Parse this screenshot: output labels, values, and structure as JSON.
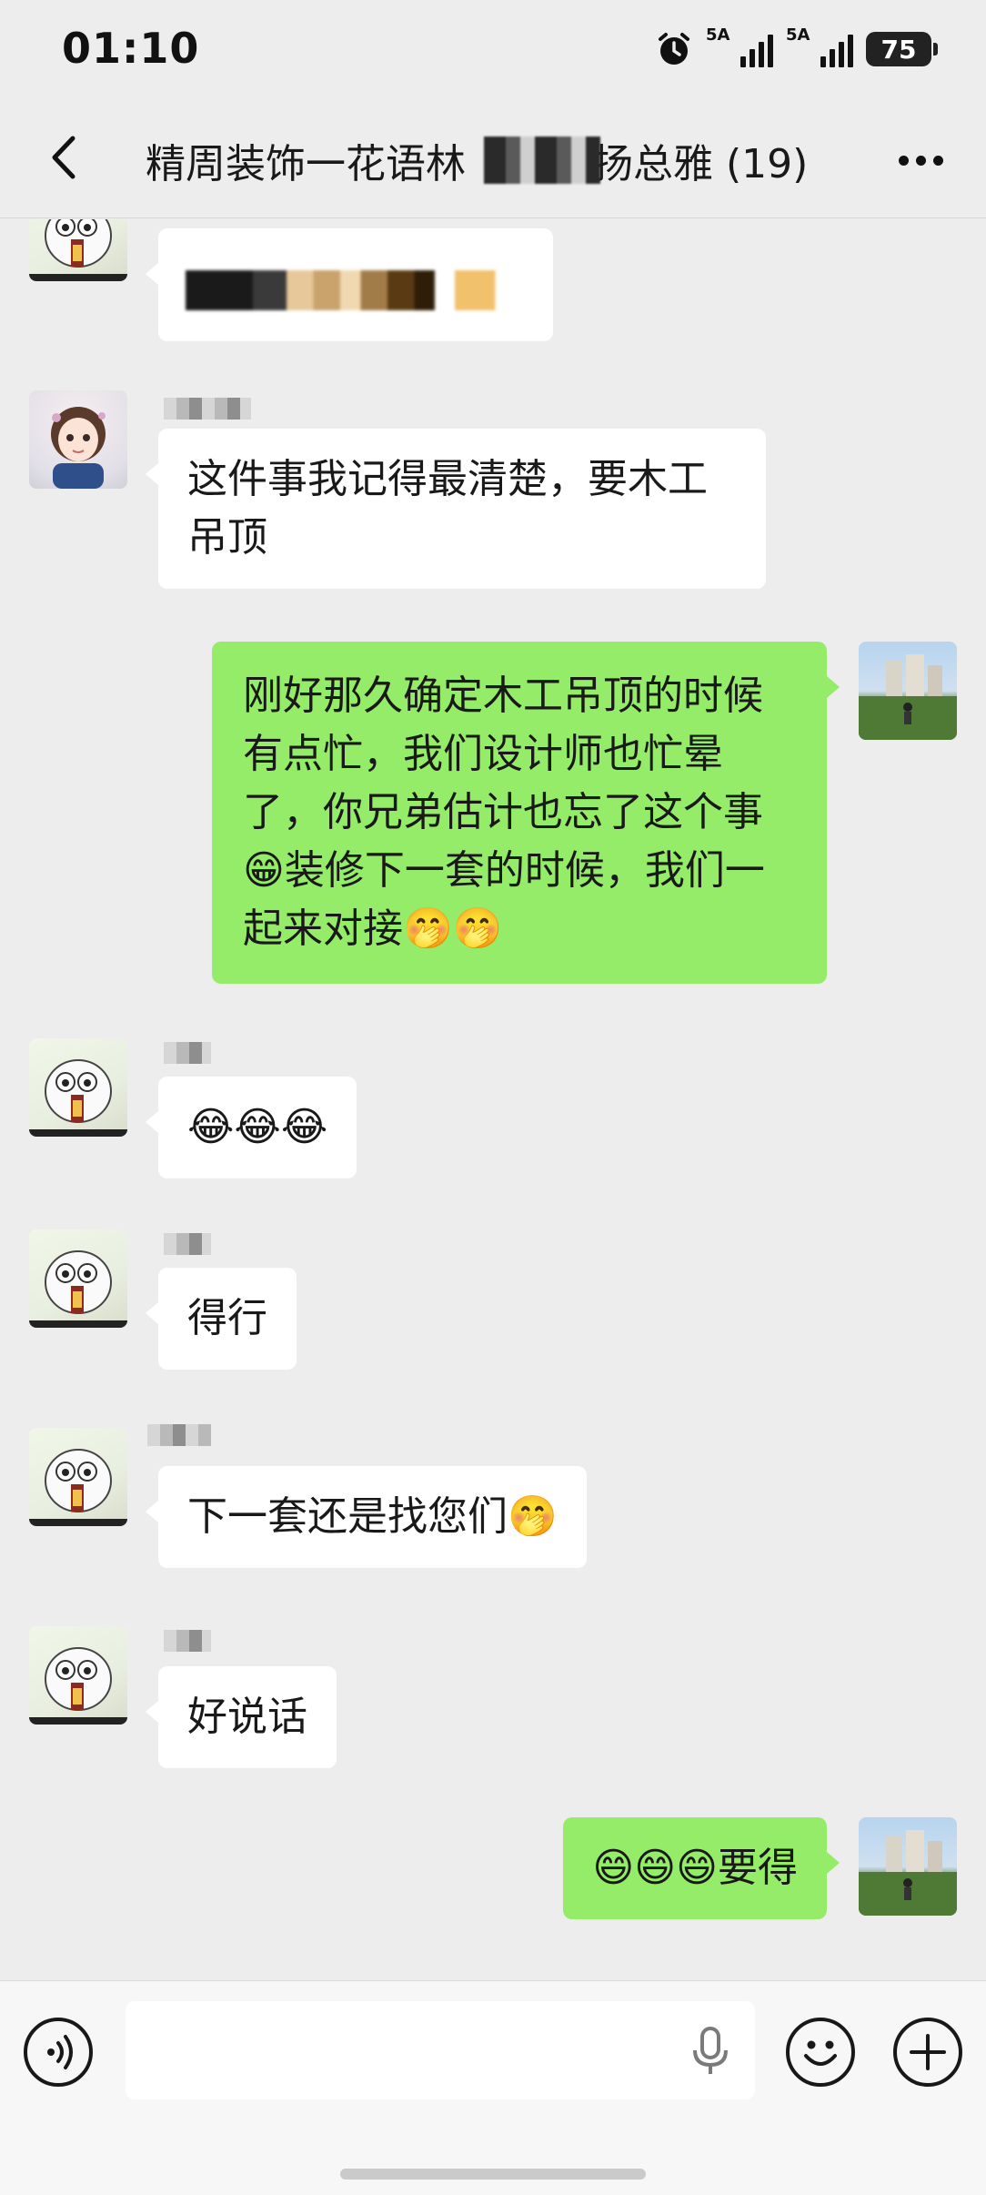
{
  "status_bar": {
    "time": "01:10",
    "signal_1_label": "5A",
    "signal_2_label": "5A",
    "battery": "75"
  },
  "header": {
    "title": "精周装饰一花语林",
    "title_tail": "扬总雅",
    "member_count": "(19)"
  },
  "messages": [
    {
      "side": "in",
      "avatar": "goat-avatar",
      "text": ""
    },
    {
      "side": "in",
      "avatar": "girl-avatar",
      "text_line1": "这件事我记得最清楚，要木工",
      "text_line2": "吊顶"
    },
    {
      "side": "out",
      "avatar": "photo-avatar",
      "lines": [
        "刚好那久确定木工吊顶的时候",
        "有点忙，我们设计师也忙晕",
        "了，你兄弟估计也忘了这个事",
        "😁装修下一套的时候，我们一",
        "起来对接🤭🤭"
      ]
    },
    {
      "side": "in",
      "avatar": "goat-avatar",
      "text": "😂😂😂"
    },
    {
      "side": "in",
      "avatar": "goat-avatar",
      "text": "得行"
    },
    {
      "side": "in",
      "avatar": "goat-avatar",
      "text": "下一套还是找您们🤭"
    },
    {
      "side": "in",
      "avatar": "goat-avatar",
      "text": "好说话"
    },
    {
      "side": "out",
      "avatar": "photo-avatar",
      "text": "😄😄😄要得"
    }
  ],
  "input_bar": {
    "value": "",
    "voice_icon": "voice-mode-icon",
    "mic_icon": "microphone-icon",
    "emoji_icon": "emoji-icon",
    "plus_icon": "plus-icon"
  }
}
